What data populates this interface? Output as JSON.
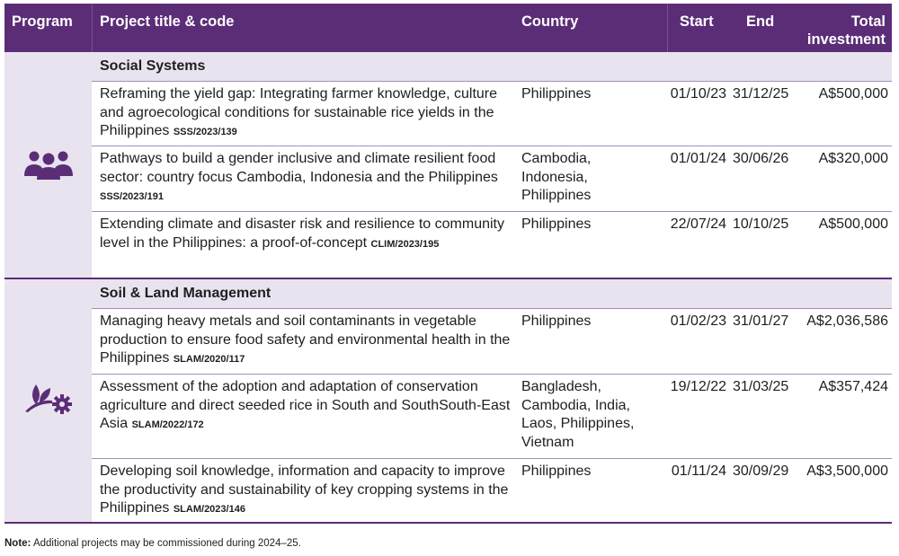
{
  "header": {
    "program": "Program",
    "title_code": "Project title & code",
    "country": "Country",
    "start": "Start",
    "end": "End",
    "total_line1": "Total",
    "total_line2": "investment"
  },
  "groups": [
    {
      "name": "Social Systems",
      "icon": "people-group-icon",
      "rows": [
        {
          "title": "Reframing the yield gap: Integrating farmer knowledge, culture and agroecological conditions for sustainable rice yields in the Philippines",
          "code": "SSS/2023/139",
          "country": "Philippines",
          "start": "01/10/23",
          "end": "31/12/25",
          "investment": "A$500,000"
        },
        {
          "title": "Pathways to build a gender inclusive and climate resilient food sector: country focus Cambodia, Indonesia and the Philippines",
          "code": "SSS/2023/191",
          "country": "Cambodia, Indonesia, Philippines",
          "start": "01/01/24",
          "end": "30/06/26",
          "investment": "A$320,000"
        },
        {
          "title": "Extending climate and disaster risk and resilience to community level in the Philippines: a proof-of-concept",
          "code": "CLIM/2023/195",
          "country": "Philippines",
          "start": "22/07/24",
          "end": "10/10/25",
          "investment": "A$500,000"
        }
      ]
    },
    {
      "name": "Soil & Land Management",
      "icon": "plant-gear-icon",
      "rows": [
        {
          "title": "Managing heavy metals and soil contaminants in vegetable production to ensure food safety and environmental health in the Philippines",
          "code": "SLAM/2020/117",
          "country": "Philippines",
          "start": "01/02/23",
          "end": "31/01/27",
          "investment": "A$2,036,586"
        },
        {
          "title": "Assessment of the adoption and adaptation of conservation agriculture and direct seeded rice in South and SouthSouth-East Asia",
          "code": "SLAM/2022/172",
          "country": "Bangladesh, Cambodia, India, Laos, Philippines, Vietnam",
          "start": "19/12/22",
          "end": "31/03/25",
          "investment": "A$357,424"
        },
        {
          "title": "Developing soil knowledge, information and capacity to improve the productivity and sustainability of key cropping systems in the Philippines",
          "code": "SLAM/2023/146",
          "country": "Philippines",
          "start": "01/11/24",
          "end": "30/09/29",
          "investment": "A$3,500,000"
        }
      ]
    }
  ],
  "note": {
    "label": "Note:",
    "text": "Additional projects may be commissioned during 2024–25."
  },
  "colors": {
    "header_bg": "#5b2d77",
    "shade": "#e9e3ef",
    "icon": "#5b2d77"
  }
}
